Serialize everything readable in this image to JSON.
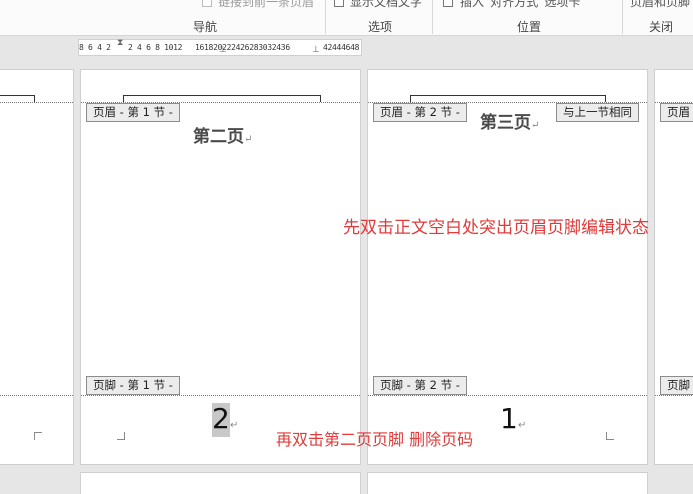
{
  "ribbon": {
    "items": {
      "link_previous": "链接到前一条页眉",
      "show_doc_text": "显示文档文字",
      "insert_align_tab": "插入“对齐方式”选项卡",
      "close_header_footer": "页眉和页脚"
    },
    "groups": {
      "navigation": "导航",
      "options": "选项",
      "position": "位置",
      "close": "关闭"
    }
  },
  "ruler": {
    "left_numbers": "8 6 4 2",
    "mid_numbers": "2 4 6 8 1012",
    "main_numbers": "161820222426283032436",
    "right_numbers": "42444648"
  },
  "pages": {
    "p1": {
      "header_tag": "页眉 - 第 1 节 -",
      "footer_tag": "页脚 - 第 1 节 -",
      "title": "第二页",
      "page_number": "2"
    },
    "p2": {
      "header_tag": "页眉 - 第 2 节 -",
      "footer_tag": "页脚 - 第 2 节 -",
      "same_as_previous": "与上一节相同",
      "title": "第三页",
      "page_number": "1"
    },
    "right_partial": {
      "header_tag": "页眉",
      "footer_tag": "页脚"
    },
    "para_mark": "↵"
  },
  "annotations": {
    "step1": "先双击正文空白处突出页眉页脚编辑状态",
    "step2": "再双击第二页页脚  删除页码"
  },
  "colors": {
    "annotation": "#e03a3a",
    "background": "#e6e6e6",
    "tag_background": "#ececec"
  }
}
